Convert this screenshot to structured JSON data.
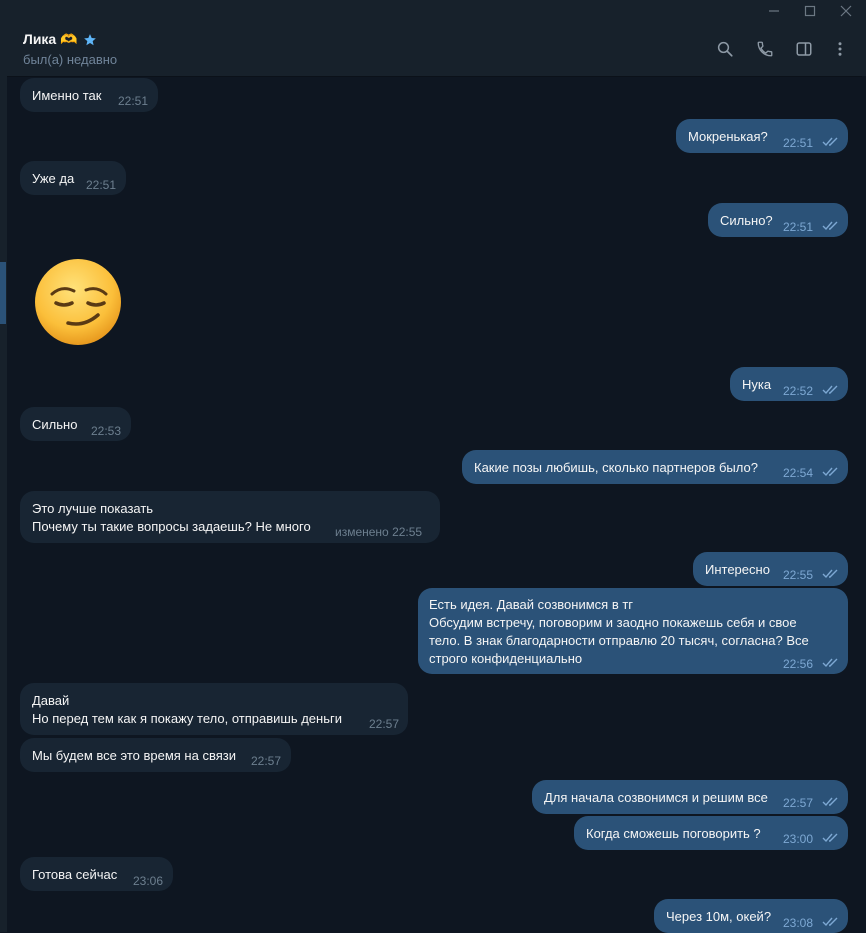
{
  "window_controls": {
    "minimize": "–",
    "maximize": "☐",
    "close": "✕"
  },
  "header": {
    "name": "Лика 🫶",
    "status": "был(а) недавно",
    "icons": [
      "search-icon",
      "phone-icon",
      "sidebar-toggle-icon",
      "more-vert-icon"
    ]
  },
  "messages": [
    {
      "dir": "in",
      "text": "Именно так",
      "time": "22:51"
    },
    {
      "dir": "out",
      "text": "Мокренькая?",
      "time": "22:51"
    },
    {
      "dir": "in",
      "text": "Уже да",
      "time": "22:51"
    },
    {
      "dir": "out",
      "text": "Сильно?",
      "time": "22:51"
    },
    {
      "dir": "in",
      "sticker": "smirking-face-emoji"
    },
    {
      "dir": "out",
      "text": "Нука",
      "time": "22:52"
    },
    {
      "dir": "in",
      "text": "Сильно",
      "time": "22:53"
    },
    {
      "dir": "out",
      "text": "Какие позы любишь, сколько партнеров было?",
      "time": "22:54"
    },
    {
      "dir": "in",
      "text": "Это лучше показать\nПочему ты такие вопросы задаешь? Не много",
      "time": "изменено 22:55"
    },
    {
      "dir": "out",
      "text": "Интересно",
      "time": "22:55"
    },
    {
      "dir": "out",
      "text": "Есть идея. Давай созвонимся в тг\nОбсудим встречу, поговорим и заодно покажешь себя и свое\nтело. В знак благодарности отправлю 20 тысяч, согласна? Все\nстрого конфиденциально",
      "time": "22:56"
    },
    {
      "dir": "in",
      "text": "Давай\nНо перед тем как я покажу тело, отправишь деньги",
      "time": "22:57"
    },
    {
      "dir": "in",
      "text": "Мы будем все это время на связи",
      "time": "22:57"
    },
    {
      "dir": "out",
      "text": "Для начала созвонимся и решим все",
      "time": "22:57"
    },
    {
      "dir": "out",
      "text": "Когда сможешь поговорить ?",
      "time": "23:00"
    },
    {
      "dir": "in",
      "text": "Готова сейчас",
      "time": "23:06"
    },
    {
      "dir": "out",
      "text": "Через 10м, окей?",
      "time": "23:08"
    }
  ],
  "colors": {
    "bg": "#0e1621",
    "incoming": "#182533",
    "outgoing": "#2b5278",
    "accent": "#5eb5f7"
  }
}
